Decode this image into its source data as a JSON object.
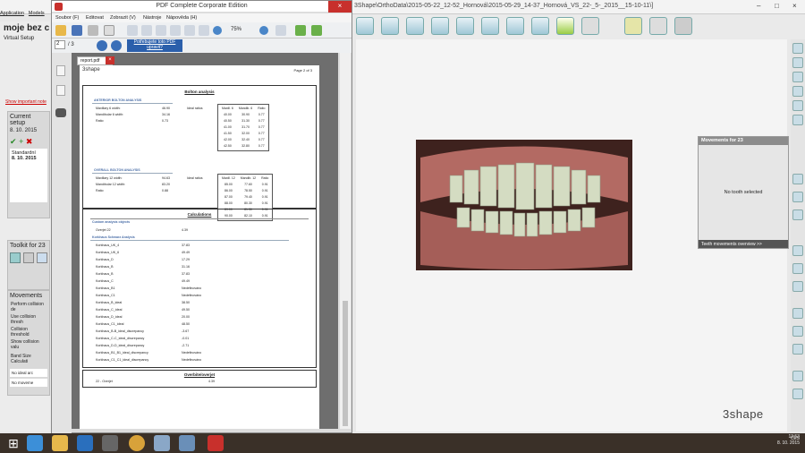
{
  "bg_app": {
    "title": "3Shape\\OrthoData\\2015-05-22_12-52_Hornová\\2015-05-29_14-37_Hornová_VS_22-_5-_2015__15-10-11\\]",
    "menu": [
      "Application",
      "Models"
    ],
    "case_title": "moje bez c",
    "case_subtitle": "Virtual Setup",
    "show_notes_link": "Show important note",
    "current_setup_label": "Current setup",
    "current_setup_date": "8. 10. 2015",
    "setups": [
      "Standardní",
      "8. 10. 2015"
    ],
    "toolkit_label": "Toolkit for 23",
    "movements_label": "Movements",
    "movement_options": [
      "Perform collision de",
      "Use collision thresh",
      "Collision threshold",
      "Show collision valu"
    ],
    "band_size_label": "Band Size Calculati",
    "no_ideal_arch": "No ideal arc",
    "no_movement": "No moveme",
    "movements_panel_title": "Movements for 23",
    "no_tooth_selected": "No tooth selected",
    "movements_overview": "Teeth movements overview >>",
    "brand": "3shape"
  },
  "pdf": {
    "window_title": "PDF Complete Corporate Edition",
    "menu": [
      "Soubor (F)",
      "Editovat",
      "Zobrazit (V)",
      "Nástroje",
      "Nápověda (H)"
    ],
    "page_current": "2",
    "page_total": "/ 3",
    "promo_line1": "Potřebujete toto PDF",
    "promo_line2": "upravit?",
    "zoom": "75%",
    "tab_name": "report.pdf",
    "page_header_logo": "3shape",
    "page_number": "Page 2 of 3",
    "bolton": {
      "title": "Bolton analysis",
      "anterior_title": "ANTERIOR BOLTON ANALYSIS",
      "anterior_rows": [
        {
          "label": "Maxillary 6 width:",
          "value": "46.90"
        },
        {
          "label": "Mandibular 6 width:",
          "value": "34.16"
        },
        {
          "label": "Ratio:",
          "value": "0.73"
        }
      ],
      "ideal_label": "Ideal ratios",
      "anterior_table_head": [
        "Maxill. 6",
        "Mandib. 6",
        "Ratio"
      ],
      "anterior_table": [
        [
          "40.00",
          "30.90",
          "0.77"
        ],
        [
          "40.50",
          "31.30",
          "0.77"
        ],
        [
          "41.00",
          "31.70",
          "0.77"
        ],
        [
          "41.50",
          "32.00",
          "0.77"
        ],
        [
          "42.00",
          "32.40",
          "0.77"
        ],
        [
          "42.50",
          "32.80",
          "0.77"
        ]
      ],
      "overall_title": "OVERALL BOLTON ANALYSIS",
      "overall_rows": [
        {
          "label": "Maxillary 12 width:",
          "value": "94.63"
        },
        {
          "label": "Mandibular 12 width:",
          "value": "83.20"
        },
        {
          "label": "Ratio:",
          "value": "0.88"
        }
      ],
      "overall_table_head": [
        "Maxill. 12",
        "Mandib. 12",
        "Ratio"
      ],
      "overall_table": [
        [
          "85.00",
          "77.60",
          "0.91"
        ],
        [
          "86.00",
          "78.50",
          "0.91"
        ],
        [
          "87.00",
          "79.40",
          "0.91"
        ],
        [
          "88.00",
          "80.30",
          "0.91"
        ],
        [
          "89.00",
          "81.30",
          "0.91"
        ],
        [
          "90.00",
          "82.10",
          "0.91"
        ]
      ]
    },
    "calculations": {
      "title": "Calculations",
      "custom_title": "Custom analysis objects",
      "custom_rows": [
        {
          "label": "Overjet 22",
          "value": "4.39"
        }
      ],
      "korkhaus_title": "Korkhaus Schwarz Analysis",
      "korkhaus_rows": [
        {
          "label": "Korkhaus_UK_4",
          "value": "37.83"
        },
        {
          "label": "Korkhaus_UK_6",
          "value": "49.49"
        },
        {
          "label": "Korkhaus_D",
          "value": "17.29"
        },
        {
          "label": "Korkhaus_B",
          "value": "31.16"
        },
        {
          "label": "Korkhaus_B",
          "value": "37.83"
        },
        {
          "label": "Korkhaus_C",
          "value": "49.49"
        },
        {
          "label": "Korkhaus_B1",
          "value": "Nedefinováno"
        },
        {
          "label": "Korkhaus_C1",
          "value": "Nedefinováno"
        },
        {
          "label": "Korkhaus_B_ideal",
          "value": "38.50"
        },
        {
          "label": "Korkhaus_C_ideal",
          "value": "49.50"
        },
        {
          "label": "Korkhaus_D_ideal",
          "value": "20.00"
        },
        {
          "label": "Korkhaus_C1_ideal",
          "value": "48.50"
        },
        {
          "label": "Korkhaus_B-B_ideal_discrepancy",
          "value": "-3.67"
        },
        {
          "label": "Korkhaus_C-C_ideal_discrepancy",
          "value": "-0.01"
        },
        {
          "label": "Korkhaus_D-D_ideal_discrepancy",
          "value": "-2.71"
        },
        {
          "label": "Korkhaus_B1_B1_ideal_discrepancy",
          "value": "Nedefinováno"
        },
        {
          "label": "Korkhaus_C1_C1_ideal_discrepancy",
          "value": "Nedefinováno"
        }
      ]
    },
    "overbite": {
      "title": "Overbite/overjet",
      "rows": [
        {
          "label": "22 - Overjet",
          "value": "4.39"
        }
      ]
    }
  },
  "taskbar": {
    "lang": "CES",
    "time": "13:53",
    "date": "8. 10. 2015"
  }
}
